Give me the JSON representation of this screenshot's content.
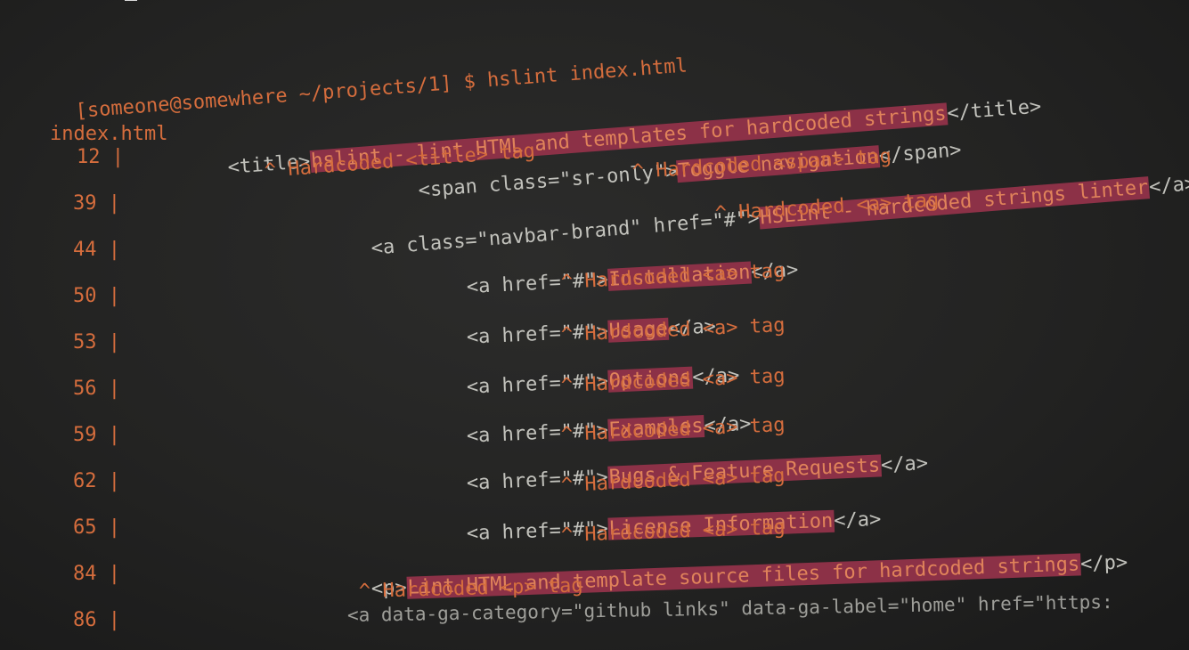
{
  "terminal": {
    "prompt": "[someone@somewhere ~/projects/1] $ ",
    "command": "hslint index.html",
    "file_name": "index.html"
  },
  "line_numbers": [
    "12 |",
    "39 |",
    "44 |",
    "50 |",
    "53 |",
    "56 |",
    "59 |",
    "62 |",
    "65 |",
    "84 |",
    "86 |"
  ],
  "findings": [
    {
      "before": "<title>",
      "text": "hslint - lint HTML and templates for hardcoded strings",
      "after": "</title>",
      "marker": "^ Hardcoded <title> tag"
    },
    {
      "before": "<span class=\"sr-only\">",
      "text": "Toggle navigation",
      "after": "</span>",
      "marker": "^ Hardcoded <span> tag"
    },
    {
      "before": "<a class=\"navbar-brand\" href=\"#\">",
      "text": "HSLint - hardcoded strings linter",
      "after": "</a>",
      "marker": "^ Hardcoded <a> tag"
    },
    {
      "before": "<a href=\"#\">",
      "text": "Installation",
      "after": "</a>",
      "marker": "^ Hardcoded <a> tag"
    },
    {
      "before": "<a href=\"#\">",
      "text": "Usage",
      "after": "</a>",
      "marker": "^ Hardcoded <a> tag"
    },
    {
      "before": "<a href=\"#\">",
      "text": "Options",
      "after": "</a>",
      "marker": "^ Hardcoded <a> tag"
    },
    {
      "before": "<a href=\"#\">",
      "text": "Examples",
      "after": "</a>",
      "marker": "^ Hardcoded <a> tag"
    },
    {
      "before": "<a href=\"#\">",
      "text": "Bugs & Feature Requests",
      "after": "</a>",
      "marker": "^ Hardcoded <a> tag"
    },
    {
      "before": "<a href=\"#\">",
      "text": "License Information",
      "after": "</a>",
      "marker": "^ Hardcoded <a> tag"
    },
    {
      "before": "<p>",
      "text": "Lint HTML and template source files for hardcoded strings",
      "after": "</p>",
      "marker": "^ Hardcoded <p> tag"
    }
  ],
  "last_line": "<a data-ga-category=\"github links\" data-ga-label=\"home\" href=\"https:",
  "colors": {
    "background": "#232322",
    "prompt_orange": "#d56d3d",
    "code_gray": "#c2c2bc",
    "highlight": "#8c3147"
  }
}
